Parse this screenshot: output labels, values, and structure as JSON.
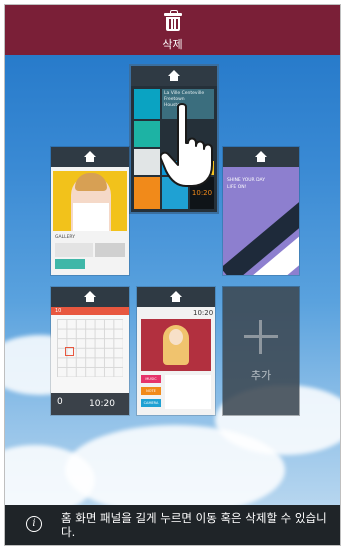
{
  "delete_bar": {
    "label": "삭제",
    "icon": "trash-icon"
  },
  "panels": {
    "top_center": {
      "text_lines": [
        "La Ville Centeville",
        "Freetown",
        "Houston"
      ],
      "clock": "10:20"
    },
    "middle_left": {
      "heading": "GALLERY"
    },
    "middle_right": {
      "text_lines": [
        "SHINE YOUR DAY",
        "LIFE ON!"
      ]
    },
    "bottom_left": {
      "month": "10",
      "clock": "10:20",
      "day": "0"
    },
    "bottom_center": {
      "clock": "10:20",
      "tags": [
        "MUSIC",
        "NOTE",
        "CAMERA"
      ]
    },
    "add": {
      "label": "추가",
      "icon": "plus-icon"
    }
  },
  "hint": {
    "text": "홈 화면 패널을 길게 누르면 이동 혹은 삭제할 수 있습니다.",
    "icon": "info-icon"
  },
  "colors": {
    "delete_bar": "#7a1f37",
    "panel_header": "#2f3a44",
    "hint_bar": "#1f2428"
  }
}
